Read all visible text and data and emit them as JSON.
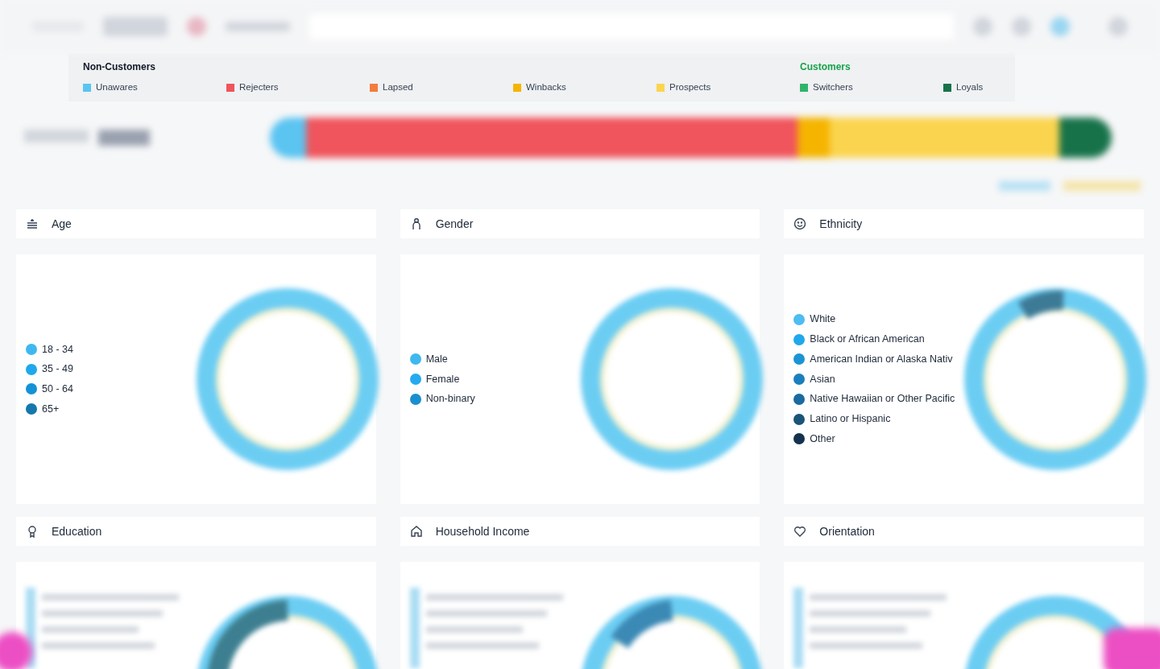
{
  "segments_legend": [
    {
      "title": "Non-Customers",
      "color": "#111827",
      "items": [
        {
          "label": "Unawares",
          "color": "#5bc4f1"
        },
        {
          "label": "Rejecters",
          "color": "#f0545c"
        },
        {
          "label": "Lapsed",
          "color": "#f47c3c"
        },
        {
          "label": "Winbacks",
          "color": "#f5b400"
        },
        {
          "label": "Prospects",
          "color": "#fbd44f"
        }
      ]
    },
    {
      "title": "Customers",
      "color": "#16a34a",
      "items": [
        {
          "label": "Switchers",
          "color": "#2fb36b"
        },
        {
          "label": "Loyals",
          "color": "#17724a"
        }
      ]
    }
  ],
  "cards": [
    {
      "title": "Age",
      "kind": "legend",
      "legend": [
        {
          "label": "18 - 34",
          "color": "#3fb8f0"
        },
        {
          "label": "35 - 49",
          "color": "#1fa8ec"
        },
        {
          "label": "50 - 64",
          "color": "#1492d6"
        },
        {
          "label": "65+",
          "color": "#1578ad"
        }
      ]
    },
    {
      "title": "Gender",
      "kind": "legend",
      "legend": [
        {
          "label": "Male",
          "color": "#3fb8f0"
        },
        {
          "label": "Female",
          "color": "#24aaee"
        },
        {
          "label": "Non-binary",
          "color": "#1a8fd0"
        }
      ]
    },
    {
      "title": "Ethnicity",
      "kind": "legend",
      "legend": [
        {
          "label": "White",
          "color": "#4dbdf2"
        },
        {
          "label": "Black or African American",
          "color": "#1fa8ec"
        },
        {
          "label": "American Indian or Alaska Nativ",
          "color": "#1c94d4"
        },
        {
          "label": "Asian",
          "color": "#1b7fbd"
        },
        {
          "label": "Native Hawaiian or Other Pacific",
          "color": "#1b6aa0"
        },
        {
          "label": "Latino or Hispanic",
          "color": "#1a5578"
        },
        {
          "label": "Other",
          "color": "#14324f"
        }
      ]
    },
    {
      "title": "Education",
      "kind": "blurred"
    },
    {
      "title": "Household Income",
      "kind": "blurred"
    },
    {
      "title": "Orientation",
      "kind": "blurred"
    }
  ]
}
